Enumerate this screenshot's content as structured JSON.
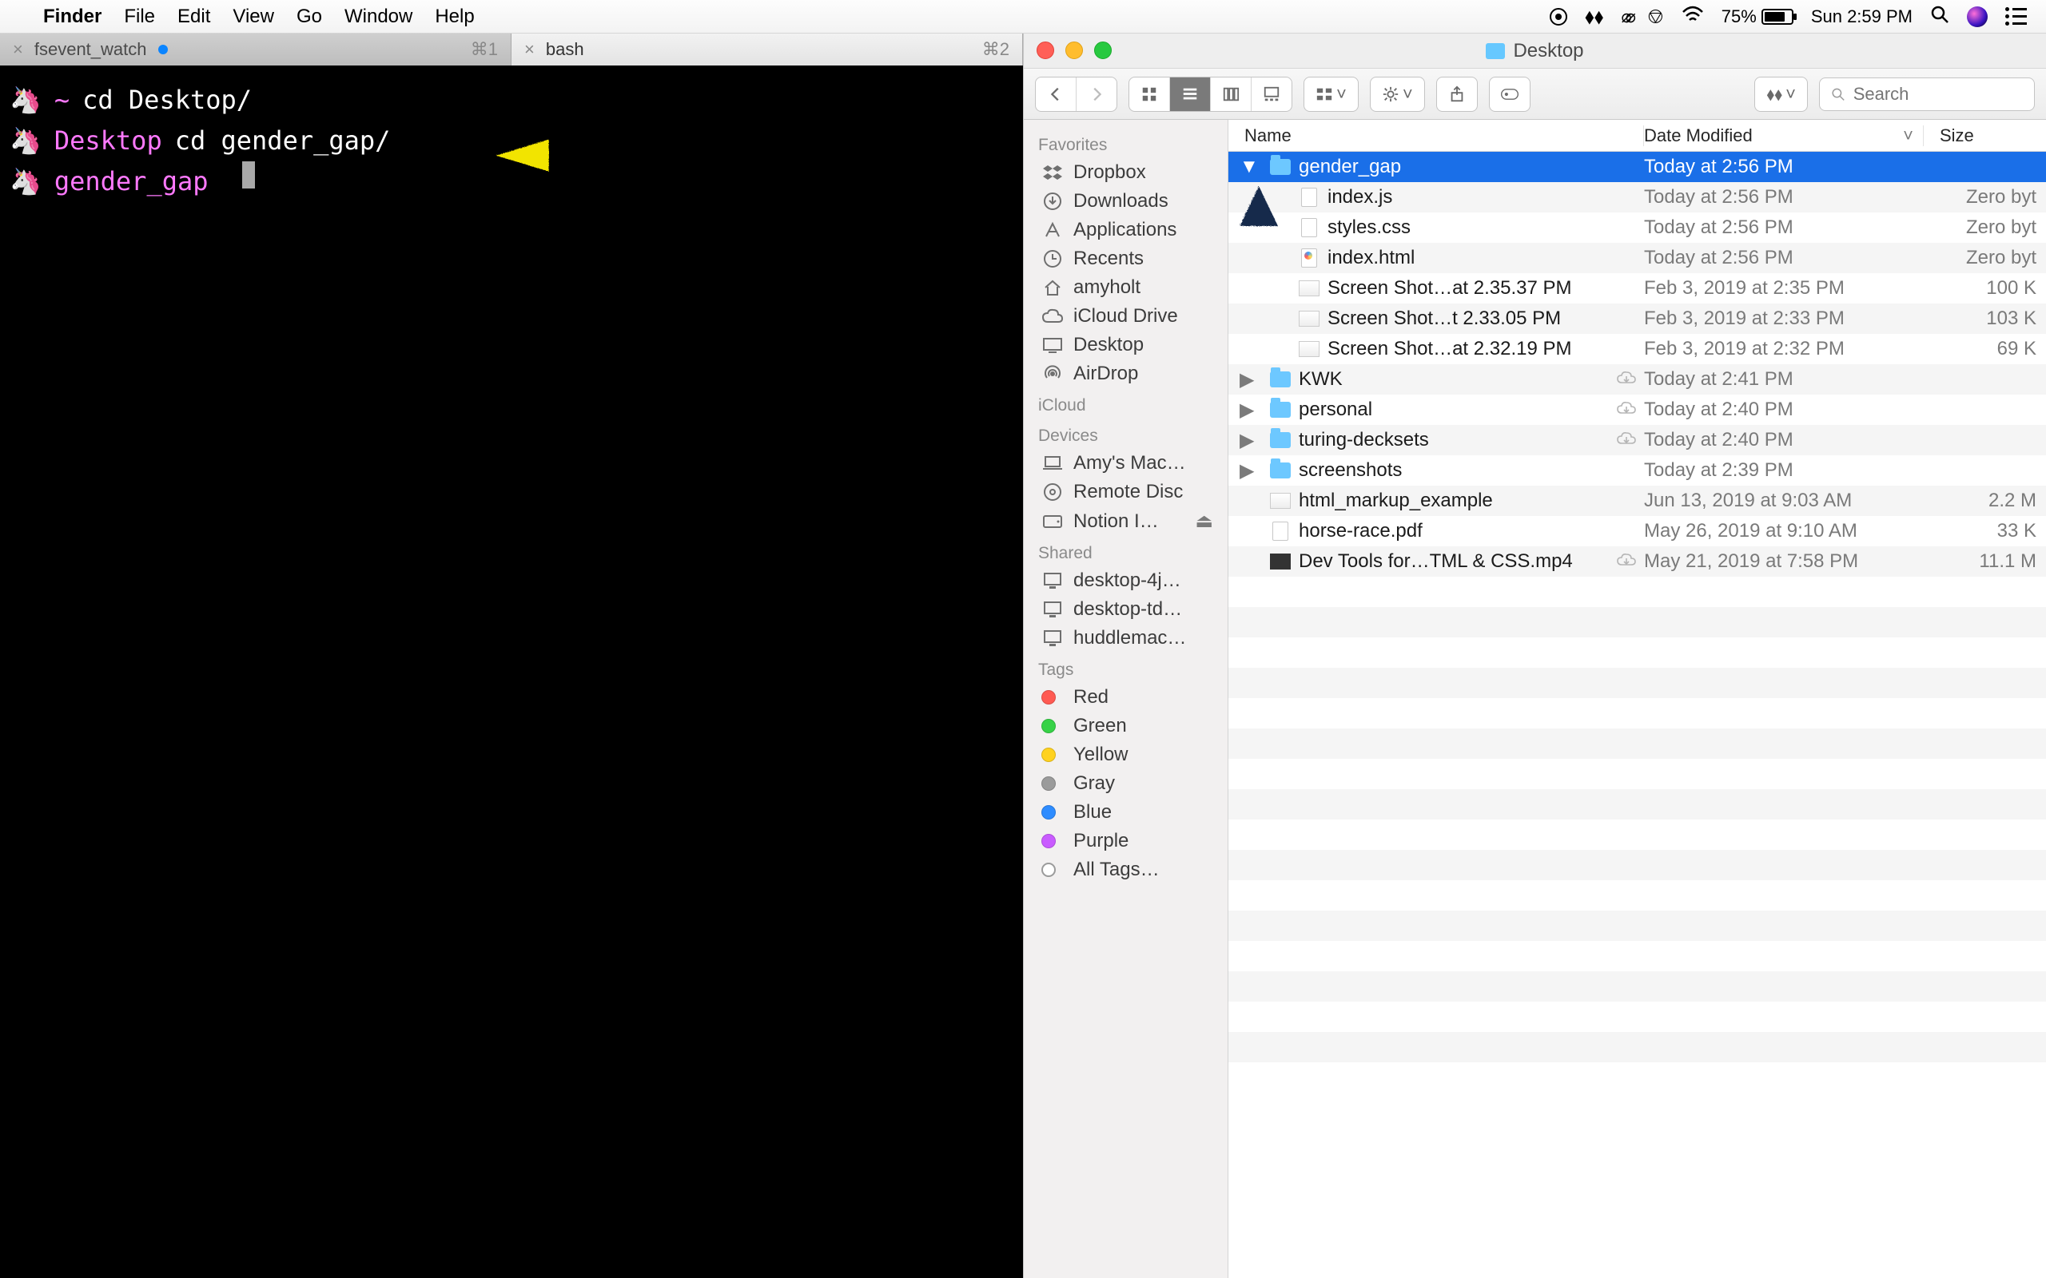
{
  "menubar": {
    "app": "Finder",
    "items": [
      "File",
      "Edit",
      "View",
      "Go",
      "Window",
      "Help"
    ],
    "battery": "75%",
    "clock": "Sun 2:59 PM"
  },
  "terminal": {
    "tabs": [
      {
        "close": "×",
        "title": "fsevent_watch",
        "shortcut": "⌘1",
        "dot": true,
        "active": false
      },
      {
        "close": "×",
        "title": "bash",
        "shortcut": "⌘2",
        "dot": false,
        "active": true
      }
    ],
    "lines": [
      {
        "icon": "🦄",
        "prompt": "~",
        "cmd": "cd Desktop/"
      },
      {
        "icon": "🦄",
        "prompt": "Desktop",
        "cmd": "cd gender_gap/"
      },
      {
        "icon": "🦄",
        "prompt": "gender_gap",
        "cmd": ""
      }
    ]
  },
  "finder": {
    "title": "Desktop",
    "search_placeholder": "Search",
    "columns": {
      "name": "Name",
      "date": "Date Modified",
      "size": "Size"
    },
    "sidebar": {
      "favorites_head": "Favorites",
      "favorites": [
        {
          "icon": "dropbox",
          "label": "Dropbox"
        },
        {
          "icon": "downloads",
          "label": "Downloads"
        },
        {
          "icon": "apps",
          "label": "Applications"
        },
        {
          "icon": "recents",
          "label": "Recents"
        },
        {
          "icon": "home",
          "label": "amyholt"
        },
        {
          "icon": "cloud",
          "label": "iCloud Drive"
        },
        {
          "icon": "desktop",
          "label": "Desktop"
        },
        {
          "icon": "airdrop",
          "label": "AirDrop"
        }
      ],
      "icloud_head": "iCloud",
      "devices_head": "Devices",
      "devices": [
        {
          "icon": "laptop",
          "label": "Amy's Mac…"
        },
        {
          "icon": "disc",
          "label": "Remote Disc"
        },
        {
          "icon": "drive",
          "label": "Notion I…",
          "eject": true
        }
      ],
      "shared_head": "Shared",
      "shared": [
        {
          "icon": "pc",
          "label": "desktop-4j…"
        },
        {
          "icon": "pc",
          "label": "desktop-td…"
        },
        {
          "icon": "pc",
          "label": "huddlemac…"
        }
      ],
      "tags_head": "Tags",
      "tags": [
        {
          "color": "#ff5a52",
          "label": "Red"
        },
        {
          "color": "#37d247",
          "label": "Green"
        },
        {
          "color": "#ffd21f",
          "label": "Yellow"
        },
        {
          "color": "#9b9b9b",
          "label": "Gray"
        },
        {
          "color": "#2e8cff",
          "label": "Blue"
        },
        {
          "color": "#c95bff",
          "label": "Purple"
        },
        {
          "color": "",
          "label": "All Tags…",
          "all": true
        }
      ]
    },
    "rows": [
      {
        "sel": true,
        "disc": "▼",
        "indent": 0,
        "kind": "folder",
        "name": "gender_gap",
        "date": "Today at 2:56 PM",
        "size": "",
        "cloud": false
      },
      {
        "sel": false,
        "disc": "",
        "indent": 1,
        "kind": "file",
        "name": "index.js",
        "date": "Today at 2:56 PM",
        "size": "Zero byt",
        "cloud": false
      },
      {
        "sel": false,
        "disc": "",
        "indent": 1,
        "kind": "file",
        "name": "styles.css",
        "date": "Today at 2:56 PM",
        "size": "Zero byt",
        "cloud": false
      },
      {
        "sel": false,
        "disc": "",
        "indent": 1,
        "kind": "html",
        "name": "index.html",
        "date": "Today at 2:56 PM",
        "size": "Zero byt",
        "cloud": false
      },
      {
        "sel": false,
        "disc": "",
        "indent": 1,
        "kind": "png",
        "name": "Screen Shot…at 2.35.37 PM",
        "date": "Feb 3, 2019 at 2:35 PM",
        "size": "100 K",
        "cloud": false
      },
      {
        "sel": false,
        "disc": "",
        "indent": 1,
        "kind": "png",
        "name": "Screen Shot…t 2.33.05 PM",
        "date": "Feb 3, 2019 at 2:33 PM",
        "size": "103 K",
        "cloud": false
      },
      {
        "sel": false,
        "disc": "",
        "indent": 1,
        "kind": "png",
        "name": "Screen Shot…at 2.32.19 PM",
        "date": "Feb 3, 2019 at 2:32 PM",
        "size": "69 K",
        "cloud": false
      },
      {
        "sel": false,
        "disc": "▶",
        "indent": 0,
        "kind": "folder",
        "name": "KWK",
        "date": "Today at 2:41 PM",
        "size": "",
        "cloud": true
      },
      {
        "sel": false,
        "disc": "▶",
        "indent": 0,
        "kind": "folder",
        "name": "personal",
        "date": "Today at 2:40 PM",
        "size": "",
        "cloud": true
      },
      {
        "sel": false,
        "disc": "▶",
        "indent": 0,
        "kind": "folder",
        "name": "turing-decksets",
        "date": "Today at 2:40 PM",
        "size": "",
        "cloud": true
      },
      {
        "sel": false,
        "disc": "▶",
        "indent": 0,
        "kind": "folder",
        "name": "screenshots",
        "date": "Today at 2:39 PM",
        "size": "",
        "cloud": false
      },
      {
        "sel": false,
        "disc": "",
        "indent": 0,
        "kind": "png",
        "name": "html_markup_example",
        "date": "Jun 13, 2019 at 9:03 AM",
        "size": "2.2 M",
        "cloud": false
      },
      {
        "sel": false,
        "disc": "",
        "indent": 0,
        "kind": "file",
        "name": "horse-race.pdf",
        "date": "May 26, 2019 at 9:10 AM",
        "size": "33 K",
        "cloud": false
      },
      {
        "sel": false,
        "disc": "",
        "indent": 0,
        "kind": "mov",
        "name": "Dev Tools for…TML & CSS.mp4",
        "date": "May 21, 2019 at 7:58 PM",
        "size": "11.1 M",
        "cloud": true
      }
    ]
  }
}
